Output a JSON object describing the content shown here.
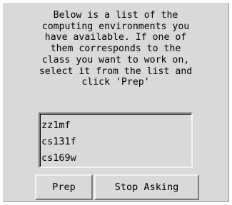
{
  "dialog": {
    "message_lines": [
      "Below is a list of the",
      "computing environments you",
      "have available. If one of",
      "them corresponds to the",
      "class you want to work on,",
      "select it from the list and",
      "click 'Prep'"
    ],
    "environments": [
      "zz1mf",
      "cs131f",
      "cs169w"
    ],
    "buttons": {
      "prep_label": "Prep",
      "stop_label": "Stop Asking"
    }
  },
  "colors": {
    "panel_background": "#d9d9d9",
    "text": "#000000",
    "bevel_light": "#f4f4f4",
    "bevel_dark": "#7a7a7a"
  }
}
